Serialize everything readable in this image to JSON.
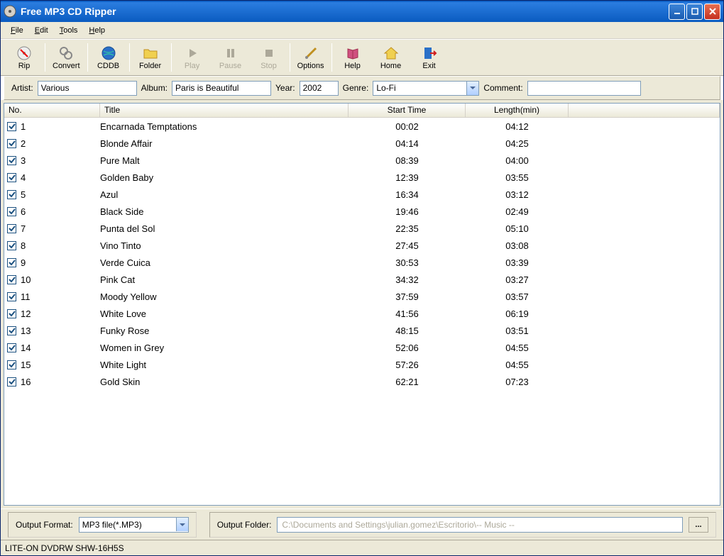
{
  "window": {
    "title": "Free MP3 CD Ripper"
  },
  "menu": {
    "file": "File",
    "edit": "Edit",
    "tools": "Tools",
    "help": "Help"
  },
  "toolbar": {
    "rip": "Rip",
    "convert": "Convert",
    "cddb": "CDDB",
    "folder": "Folder",
    "play": "Play",
    "pause": "Pause",
    "stop": "Stop",
    "options": "Options",
    "help": "Help",
    "home": "Home",
    "exit": "Exit"
  },
  "info": {
    "artist_label": "Artist:",
    "artist": "Various",
    "album_label": "Album:",
    "album": "Paris is Beautiful",
    "year_label": "Year:",
    "year": "2002",
    "genre_label": "Genre:",
    "genre": "Lo-Fi",
    "comment_label": "Comment:",
    "comment": ""
  },
  "columns": {
    "no": "No.",
    "title": "Title",
    "start": "Start Time",
    "length": "Length(min)"
  },
  "tracks": [
    {
      "no": "1",
      "title": "Encarnada Temptations",
      "start": "00:02",
      "length": "04:12"
    },
    {
      "no": "2",
      "title": "Blonde Affair",
      "start": "04:14",
      "length": "04:25"
    },
    {
      "no": "3",
      "title": "Pure Malt",
      "start": "08:39",
      "length": "04:00"
    },
    {
      "no": "4",
      "title": "Golden Baby",
      "start": "12:39",
      "length": "03:55"
    },
    {
      "no": "5",
      "title": "Azul",
      "start": "16:34",
      "length": "03:12"
    },
    {
      "no": "6",
      "title": "Black Side",
      "start": "19:46",
      "length": "02:49"
    },
    {
      "no": "7",
      "title": "Punta del Sol",
      "start": "22:35",
      "length": "05:10"
    },
    {
      "no": "8",
      "title": "Vino Tinto",
      "start": "27:45",
      "length": "03:08"
    },
    {
      "no": "9",
      "title": "Verde Cuica",
      "start": "30:53",
      "length": "03:39"
    },
    {
      "no": "10",
      "title": "Pink Cat",
      "start": "34:32",
      "length": "03:27"
    },
    {
      "no": "11",
      "title": "Moody Yellow",
      "start": "37:59",
      "length": "03:57"
    },
    {
      "no": "12",
      "title": "White Love",
      "start": "41:56",
      "length": "06:19"
    },
    {
      "no": "13",
      "title": "Funky Rose",
      "start": "48:15",
      "length": "03:51"
    },
    {
      "no": "14",
      "title": "Women in Grey",
      "start": "52:06",
      "length": "04:55"
    },
    {
      "no": "15",
      "title": "White Light",
      "start": "57:26",
      "length": "04:55"
    },
    {
      "no": "16",
      "title": "Gold Skin",
      "start": "62:21",
      "length": "07:23"
    }
  ],
  "output": {
    "format_label": "Output Format:",
    "format": "MP3 file(*.MP3)",
    "folder_label": "Output Folder:",
    "folder": "C:\\Documents and Settings\\julian.gomez\\Escritorio\\-- Music --",
    "browse": "..."
  },
  "status": "LITE-ON DVDRW SHW-16H5S"
}
